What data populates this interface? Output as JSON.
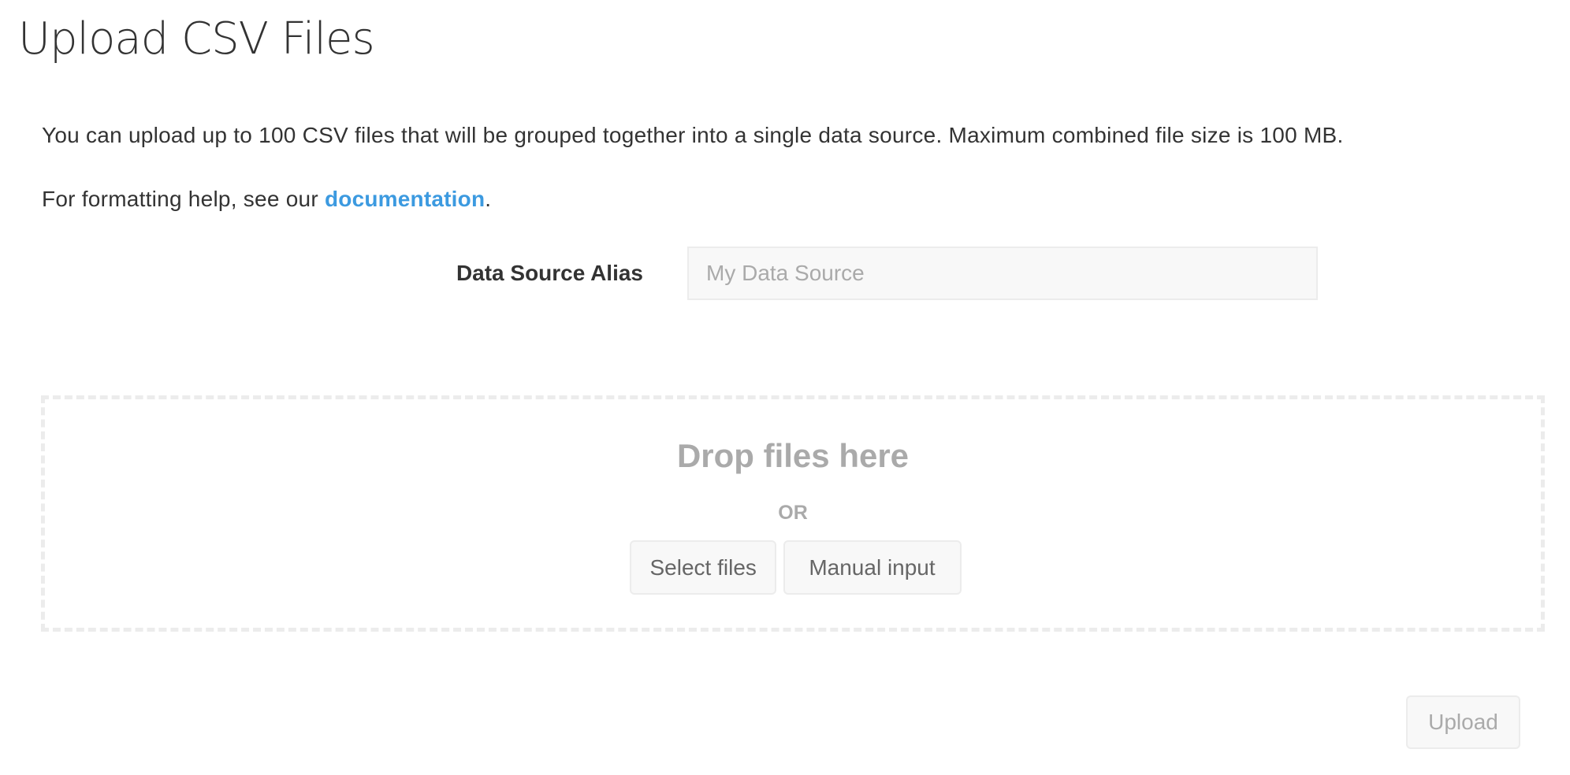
{
  "page": {
    "title": "Upload CSV Files"
  },
  "intro": {
    "text": "You can upload up to 100 CSV files that will be grouped together into a single data source. Maximum combined file size is 100 MB."
  },
  "help": {
    "prefix": "For formatting help, see our ",
    "link_label": "documentation",
    "suffix": "."
  },
  "alias": {
    "label": "Data Source Alias",
    "value": "",
    "placeholder": "My Data Source"
  },
  "dropzone": {
    "title": "Drop files here",
    "separator": "OR",
    "select_files_label": "Select files",
    "manual_input_label": "Manual input"
  },
  "footer": {
    "upload_label": "Upload",
    "upload_disabled": true
  },
  "colors": {
    "link": "#3c9ae0",
    "text": "#333333",
    "muted": "#aaaaaa",
    "button_text": "#666666",
    "border": "#ececec",
    "field_bg": "#f8f8f8"
  }
}
